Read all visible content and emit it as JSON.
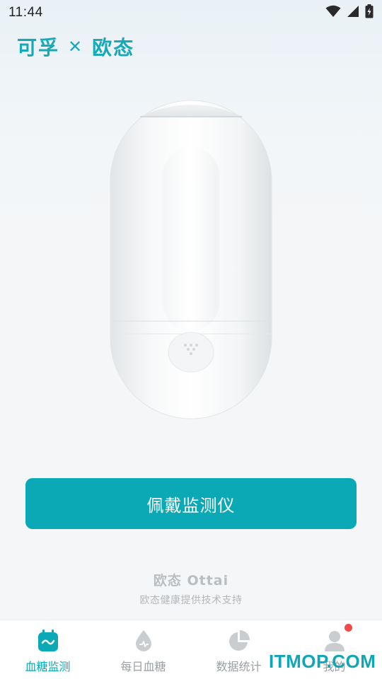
{
  "status_bar": {
    "time": "11:44"
  },
  "brand": {
    "left": "可孚",
    "separator": "✕",
    "right": "欧态"
  },
  "device": {
    "image_name": "ottai-cgm-device"
  },
  "cta": {
    "label": "佩戴监测仪"
  },
  "footer": {
    "brand": "欧态 Ottai",
    "tagline": "欧态健康提供技术支持"
  },
  "tabs": [
    {
      "label": "血糖监测",
      "icon": "glucose-monitor-icon",
      "active": true
    },
    {
      "label": "每日血糖",
      "icon": "blood-drop-icon",
      "active": false
    },
    {
      "label": "数据统计",
      "icon": "pie-chart-icon",
      "active": false
    },
    {
      "label": "我的",
      "icon": "user-icon",
      "active": false,
      "badge": true
    }
  ],
  "watermark": "ITMOP.COM",
  "colors": {
    "accent": "#0aa9b5",
    "brand": "#17a9b8",
    "badge": "#f04a4a"
  }
}
